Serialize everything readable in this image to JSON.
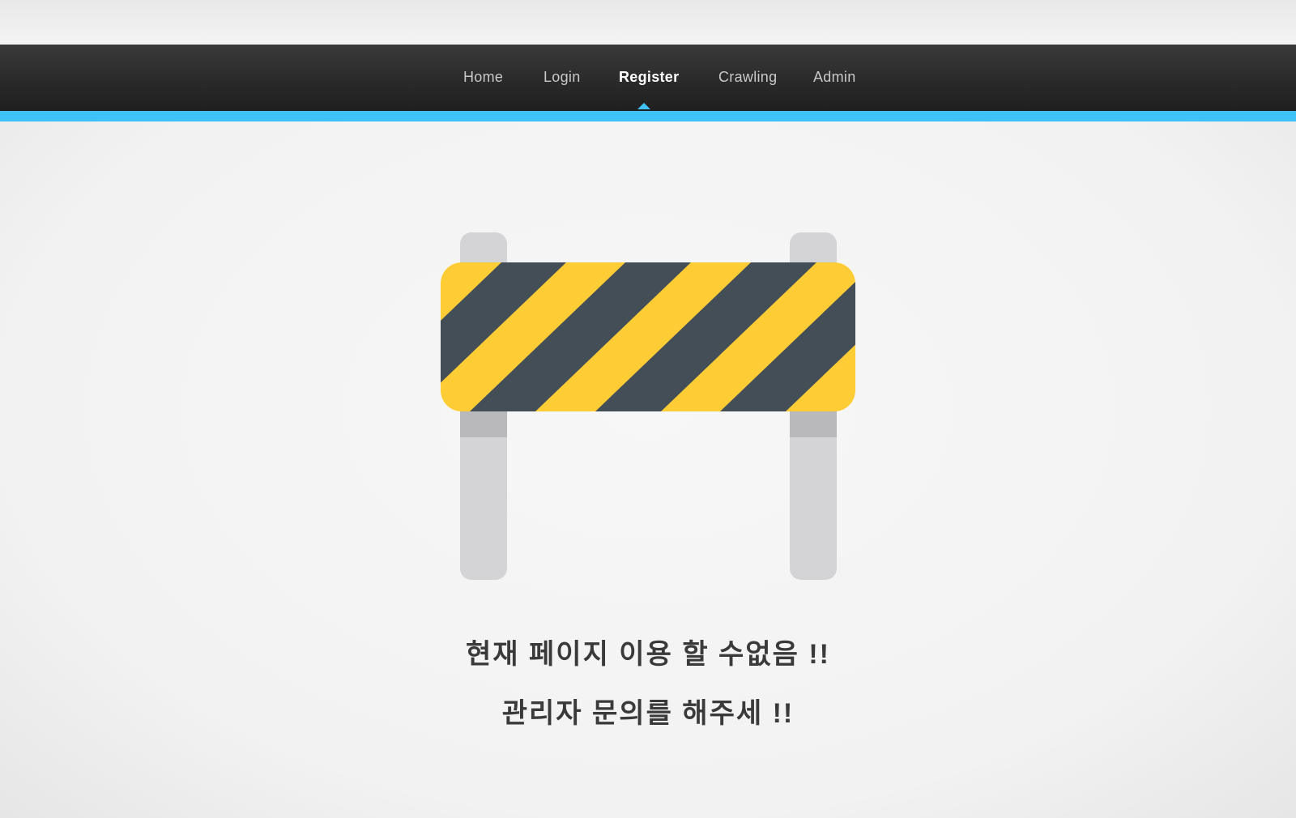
{
  "nav": {
    "items": [
      {
        "label": "Home"
      },
      {
        "label": "Login"
      },
      {
        "label": "Register",
        "active": true
      },
      {
        "label": "Crawling"
      },
      {
        "label": "Admin"
      }
    ]
  },
  "colors": {
    "accent": "#3ec2f7",
    "stripe_yellow": "#fecd36",
    "stripe_dark": "#434e57",
    "post_gray": "#d4d3d5"
  },
  "illustration": {
    "icon": "road-barrier-icon"
  },
  "messages": {
    "line1": "현재 페이지 이용 할 수없음 !!",
    "line2": "관리자 문의를 해주세 !!"
  }
}
